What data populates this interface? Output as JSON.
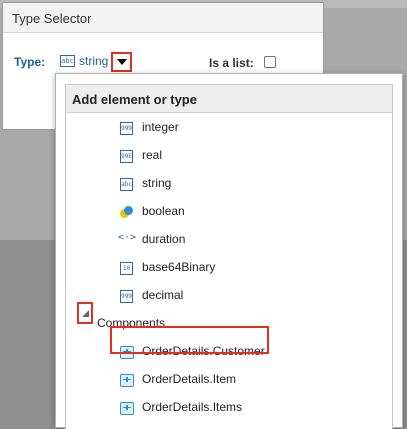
{
  "dialog": {
    "title": "Type Selector",
    "type_label": "Type:",
    "type_value": "string",
    "type_icon_text": "abc",
    "is_list_label": "Is a list:",
    "is_list_checked": false
  },
  "popup": {
    "header": "Add element or type",
    "items": [
      {
        "label": "integer",
        "icon": "integer-icon",
        "icon_text": "999"
      },
      {
        "label": "real",
        "icon": "real-icon",
        "icon_text": "99E"
      },
      {
        "label": "string",
        "icon": "string-icon",
        "icon_text": "abc"
      },
      {
        "label": "boolean",
        "icon": "boolean-icon",
        "icon_text": ""
      },
      {
        "label": "duration",
        "icon": "duration-icon",
        "icon_text": "<·>"
      },
      {
        "label": "base64Binary",
        "icon": "binary-icon",
        "icon_text": "10"
      },
      {
        "label": "decimal",
        "icon": "decimal-icon",
        "icon_text": "999"
      }
    ],
    "section": {
      "label": "Components",
      "expanded": true
    },
    "components": [
      {
        "label": "OrderDetails.Customer",
        "highlighted": true
      },
      {
        "label": "OrderDetails.Item",
        "highlighted": false
      },
      {
        "label": "OrderDetails.Items",
        "highlighted": false
      }
    ]
  },
  "colors": {
    "accent": "#1f5f96",
    "highlight": "#e0311d"
  }
}
